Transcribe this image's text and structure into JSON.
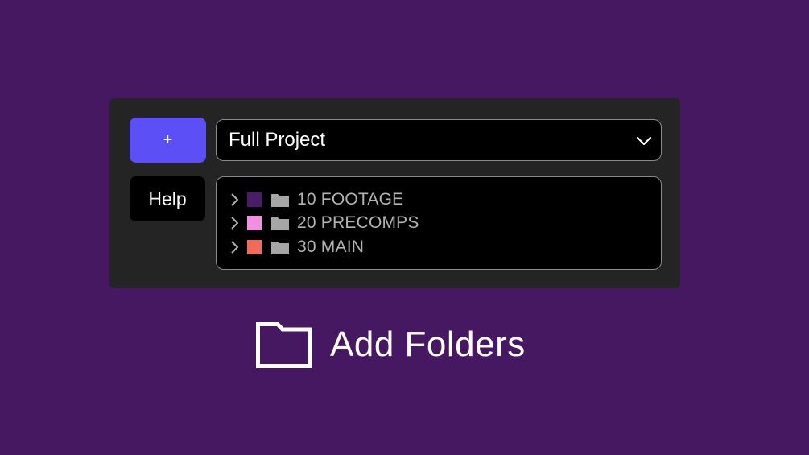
{
  "colors": {
    "background": "#461861",
    "panel": "#242424",
    "add_button": "#5b4ff5"
  },
  "toolbar": {
    "add_label": "+",
    "help_label": "Help",
    "add_icon": "plus-icon"
  },
  "dropdown": {
    "value": "Full Project",
    "icon": "chevron-down-icon"
  },
  "tree": {
    "items": [
      {
        "label": "10 FOOTAGE",
        "color": "#4b1c6b"
      },
      {
        "label": "20 PRECOMPS",
        "color": "#f38fe0"
      },
      {
        "label": "30 MAIN",
        "color": "#f36a5c"
      }
    ]
  },
  "headline": {
    "text": "Add Folders",
    "icon": "folder-outline-icon"
  }
}
